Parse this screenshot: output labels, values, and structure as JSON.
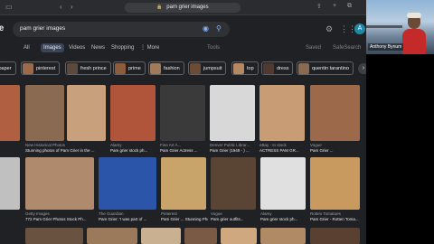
{
  "browser": {
    "url": "pam grier images",
    "nav_icons": [
      "sidebar-icon",
      "back-icon",
      "forward-icon"
    ]
  },
  "google": {
    "logo_fragment": "le",
    "search_query": "pam grier images",
    "avatar_letter": "A"
  },
  "tabs": [
    {
      "label": "All",
      "active": false
    },
    {
      "label": "Images",
      "active": true
    },
    {
      "label": "Videos",
      "active": false
    },
    {
      "label": "News",
      "active": false
    },
    {
      "label": "Shopping",
      "active": false
    },
    {
      "label": "⋮ More",
      "active": false
    },
    {
      "label": "Tools",
      "active": false
    },
    {
      "label": "Saved",
      "active": false
    },
    {
      "label": "SafeSearch",
      "active": false
    }
  ],
  "chips": [
    {
      "label": "allpaper",
      "color": "#7a5a42"
    },
    {
      "label": "pinterest",
      "color": "#9b6a4c"
    },
    {
      "label": "fresh prince",
      "color": "#5d4a3e"
    },
    {
      "label": "prime",
      "color": "#8c5c3c"
    },
    {
      "label": "fashion",
      "color": "#a07a5a"
    },
    {
      "label": "jumpsuit",
      "color": "#6c4b36"
    },
    {
      "label": "top",
      "color": "#b58862"
    },
    {
      "label": "dress",
      "color": "#4e3a30"
    },
    {
      "label": "quentin tarantino",
      "color": "#8a6a50"
    }
  ],
  "images_row1": [
    {
      "source": "",
      "title": "",
      "color": "#b06040"
    },
    {
      "source": "New Historical Photos",
      "title": "Stunning photos of Pam Grier in the ...",
      "color": "#8a6b52"
    },
    {
      "source": "",
      "title": "",
      "color": "#c8a07c"
    },
    {
      "source": "Alamy",
      "title": "Pam grier stock ph...",
      "color": "#b0553a"
    },
    {
      "source": "Fine Art A...",
      "title": "Pam Grier Actress ...",
      "color": "#3a3a3a"
    },
    {
      "source": "Denver Public Librar...",
      "title": "Pam Grier (1949 - ) ...",
      "color": "#d8d8d8"
    },
    {
      "source": "eBay · In stock",
      "title": "ACTRESS PAM GR...",
      "color": "#c89c74"
    },
    {
      "source": "Vogue",
      "title": "Pam Grier ...",
      "color": "#9c6a4a"
    }
  ],
  "images_row2": [
    {
      "source": "",
      "title": "",
      "color": "#c0c0c0"
    },
    {
      "source": "Getty Images",
      "title": "772 Pam Grier Photos Stock Ph...",
      "color": "#b08a6c"
    },
    {
      "source": "The Guardian",
      "title": "Pam Grier: 'I was part of ...",
      "color": "#2a55a8"
    },
    {
      "source": "Pinterest",
      "title": "Pam Grier ... Stunning Photos...",
      "color": "#c9a46a"
    },
    {
      "source": "Vogue",
      "title": "Pam grier outfits...",
      "color": "#5a4434"
    },
    {
      "source": "Alamy",
      "title": "Pam grier stock ph...",
      "color": "#e0e0e0"
    },
    {
      "source": "Rotten Tomatoes",
      "title": "Pam Grier - Rotten Toma...",
      "color": "#c89a60"
    }
  ],
  "webcam": {
    "name": "Anthony Bynum"
  }
}
